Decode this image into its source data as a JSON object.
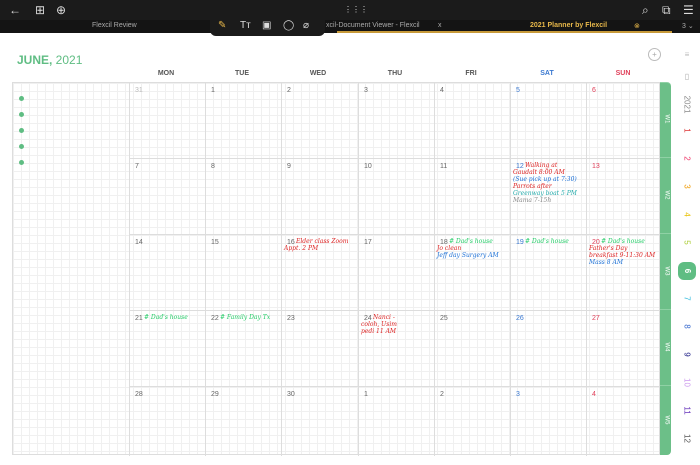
{
  "topbar": {
    "back": "←",
    "grid": "⊞",
    "add": "⊕",
    "apps": "⋮⋮⋮",
    "search": "⌕",
    "split": "⧉",
    "menu": "☰"
  },
  "tabs": [
    {
      "label": "Flexcil Review"
    },
    {
      "label": "xcil-Document Viewer - Flexcil"
    },
    {
      "label": "2021 Planner by Flexcil"
    }
  ],
  "tab_close": "x",
  "tab_count": "3 ⌄",
  "tab_close_active": "⊗",
  "tools": {
    "pen": "✎",
    "text": "Tт",
    "image": "▣",
    "lasso": "◯",
    "eraser": "⌀"
  },
  "title": {
    "month": "JUNE,",
    "year": " 2021"
  },
  "days": [
    "MON",
    "TUE",
    "WED",
    "THU",
    "FRI",
    "SAT",
    "SUN"
  ],
  "weeks": [
    [
      "31",
      "1",
      "2",
      "3",
      "4",
      "5",
      "6"
    ],
    [
      "7",
      "8",
      "9",
      "10",
      "11",
      "12",
      "13"
    ],
    [
      "14",
      "15",
      "16",
      "17",
      "18",
      "19",
      "20"
    ],
    [
      "21",
      "22",
      "23",
      "24",
      "25",
      "26",
      "27"
    ],
    [
      "28",
      "29",
      "30",
      "1",
      "2",
      "3",
      "4"
    ]
  ],
  "week_labels": [
    "W1",
    "W2",
    "W3",
    "W4",
    "W5"
  ],
  "notes": [
    {
      "w": 1,
      "d": 5,
      "lines": [
        [
          "Walking at",
          "#d22"
        ],
        [
          "Gaudalt 8:00 AM",
          "#d22"
        ],
        [
          "(Sue pick up at 7:30)",
          "#1a6fd6"
        ],
        [
          "Parrots after",
          "#d22"
        ],
        [
          "Greenway boat 5 PM",
          "#2aa"
        ],
        [
          "Mama 7-15h",
          "#888"
        ]
      ]
    },
    {
      "w": 2,
      "d": 2,
      "lines": [
        [
          "Elder class Zoom",
          "#d22"
        ],
        [
          "Appt.      2 PM",
          "#d22"
        ]
      ]
    },
    {
      "w": 2,
      "d": 4,
      "lines": [
        [
          "# Dad's house",
          "#2c6"
        ],
        [
          "Jo clean",
          "#d22"
        ],
        [
          "Jeff day Surgery AM",
          "#1a6fd6"
        ]
      ]
    },
    {
      "w": 2,
      "d": 5,
      "lines": [
        [
          "# Dad's house",
          "#2c6"
        ]
      ]
    },
    {
      "w": 2,
      "d": 6,
      "lines": [
        [
          "# Dad's house",
          "#2c6"
        ],
        [
          "Father's Day",
          "#d22"
        ],
        [
          "breakfast 9-11:30 AM",
          "#d22"
        ],
        [
          "Mass 8 AM",
          "#1a6fd6"
        ]
      ]
    },
    {
      "w": 3,
      "d": 0,
      "lines": [
        [
          "# Dad's house",
          "#2c6"
        ]
      ]
    },
    {
      "w": 3,
      "d": 1,
      "lines": [
        [
          "# Family Day Tx",
          "#2c6"
        ]
      ]
    },
    {
      "w": 3,
      "d": 3,
      "lines": [
        [
          "Nanci -",
          "#d22"
        ],
        [
          "coloh, Usim",
          "#d22"
        ],
        [
          "pedi 11 AM",
          "#d22"
        ]
      ]
    }
  ],
  "months": [
    {
      "n": "1",
      "c": "#d33"
    },
    {
      "n": "2",
      "c": "#e36"
    },
    {
      "n": "3",
      "c": "#e90"
    },
    {
      "n": "4",
      "c": "#e8c000"
    },
    {
      "n": "5",
      "c": "#ac3"
    },
    {
      "n": "6",
      "c": "#fff"
    },
    {
      "n": "7",
      "c": "#3bd"
    },
    {
      "n": "8",
      "c": "#36c"
    },
    {
      "n": "9",
      "c": "#228"
    },
    {
      "n": "10",
      "c": "#c9e"
    },
    {
      "n": "11",
      "c": "#63b"
    },
    {
      "n": "12",
      "c": "#555"
    }
  ],
  "year_label": "2021",
  "accent": "#5fbd83"
}
